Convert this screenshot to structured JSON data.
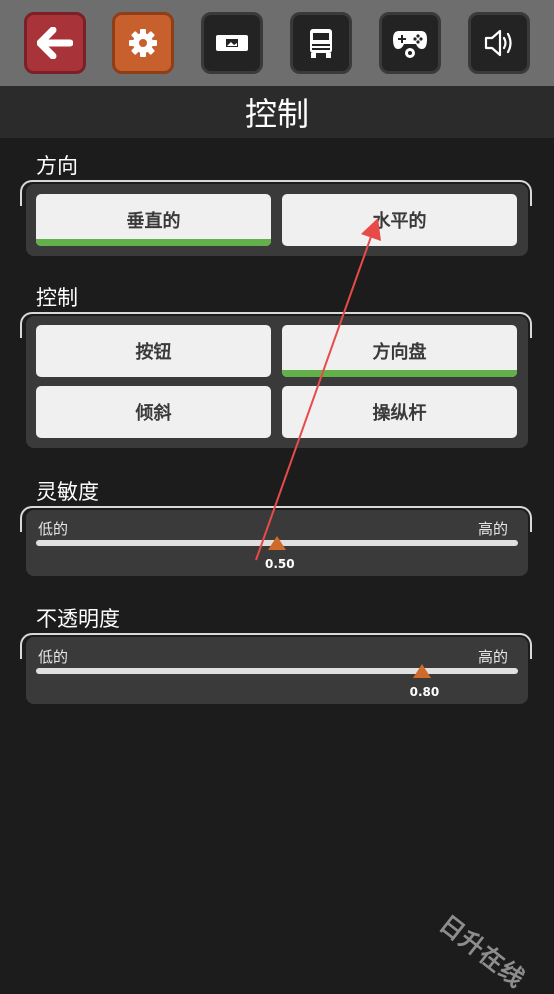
{
  "toolbar": {
    "buttons": [
      {
        "icon": "back-arrow-icon"
      },
      {
        "icon": "gear-icon",
        "active": true
      },
      {
        "icon": "display-icon"
      },
      {
        "icon": "truck-icon"
      },
      {
        "icon": "gamepad-settings-icon"
      },
      {
        "icon": "speaker-icon"
      }
    ]
  },
  "title": "控制",
  "direction": {
    "label": "方向",
    "options": [
      "垂直的",
      "水平的"
    ],
    "selected": "垂直的"
  },
  "control": {
    "label": "控制",
    "options": [
      "按钮",
      "方向盘",
      "倾斜",
      "操纵杆"
    ],
    "selected": "方向盘"
  },
  "sensitivity": {
    "label": "灵敏度",
    "low": "低的",
    "high": "高的",
    "value": 0.5,
    "value_text": "0.50"
  },
  "opacity": {
    "label": "不透明度",
    "low": "低的",
    "high": "高的",
    "value": 0.8,
    "value_text": "0.80"
  },
  "watermark": "日升在线",
  "colors": {
    "accent_orange": "#d06a2a",
    "selected_green": "#63b04a",
    "annotation_red": "#e84a4a"
  }
}
